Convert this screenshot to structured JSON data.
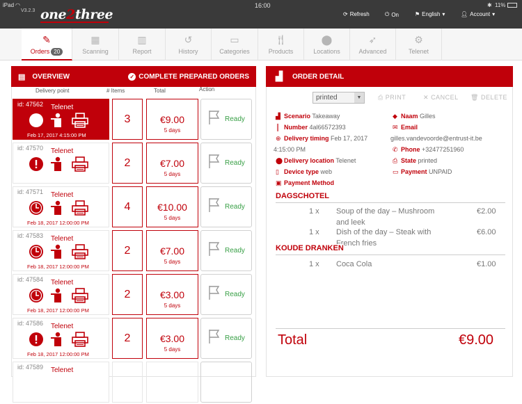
{
  "status": {
    "device": "iPad",
    "time": "16:00",
    "battery": "11%"
  },
  "app": {
    "version": "V3.2.3",
    "logo_a": "one",
    "logo_b": "2",
    "logo_c": "three"
  },
  "topnav": {
    "refresh": "Refresh",
    "on": "On",
    "language": "English",
    "account": "Account"
  },
  "nav": [
    {
      "label": "Orders",
      "badge": "20",
      "icon": "pencil-icon",
      "active": true
    },
    {
      "label": "Scanning",
      "icon": "qrcode-icon"
    },
    {
      "label": "Report",
      "icon": "bar-chart-icon"
    },
    {
      "label": "History",
      "icon": "history-icon"
    },
    {
      "label": "Categories",
      "icon": "folder-icon"
    },
    {
      "label": "Products",
      "icon": "cutlery-icon"
    },
    {
      "label": "Locations",
      "icon": "map-marker-icon"
    },
    {
      "label": "Advanced",
      "icon": "rocket-icon"
    },
    {
      "label": "Telenet",
      "icon": "gear-icon"
    }
  ],
  "overview": {
    "title": "OVERVIEW",
    "complete": "COMPLETE PREPARED ORDERS",
    "cols": {
      "delivery": "Delivery point",
      "items": "# Items",
      "total": "Total",
      "action": "Action"
    },
    "orders": [
      {
        "id": "id: 47562",
        "name": "Telenet",
        "date": "Feb 17, 2017 4:15:00 PM",
        "items": "3",
        "total": "€9.00",
        "days": "5 days",
        "action": "Ready",
        "status": "clock"
      },
      {
        "id": "id: 47570",
        "name": "Telenet",
        "date": "",
        "items": "2",
        "total": "€7.00",
        "days": "5 days",
        "action": "Ready",
        "status": "alert"
      },
      {
        "id": "id: 47571",
        "name": "Telenet",
        "date": "Feb 18, 2017 12:00:00 PM",
        "items": "4",
        "total": "€10.00",
        "days": "5 days",
        "action": "Ready",
        "status": "clock"
      },
      {
        "id": "id: 47583",
        "name": "Telenet",
        "date": "Feb 18, 2017 12:00:00 PM",
        "items": "2",
        "total": "€7.00",
        "days": "5 days",
        "action": "Ready",
        "status": "clock"
      },
      {
        "id": "id: 47584",
        "name": "Telenet",
        "date": "Feb 18, 2017 12:00:00 PM",
        "items": "2",
        "total": "€3.00",
        "days": "5 days",
        "action": "Ready",
        "status": "clock"
      },
      {
        "id": "id: 47586",
        "name": "Telenet",
        "date": "Feb 18, 2017 12:00:00 PM",
        "items": "2",
        "total": "€3.00",
        "days": "5 days",
        "action": "Ready",
        "status": "alert"
      },
      {
        "id": "id: 47589",
        "name": "Telenet",
        "date": "",
        "items": "",
        "total": "",
        "days": "",
        "action": "",
        "status": ""
      }
    ]
  },
  "detail": {
    "title": "ORDER DETAIL",
    "print_state": "printed",
    "print": "PRINT",
    "cancel": "CANCEL",
    "delete": "DELETE",
    "scenario_k": "Scenario",
    "scenario_v": "Takeaway",
    "number_k": "Number",
    "number_v": "4al66572393",
    "timing_k": "Delivery timing",
    "timing_v": "Feb 17, 2017",
    "timing_v2": "4:15:00 PM",
    "location_k": "Delivery location",
    "location_v": "Telenet",
    "device_k": "Device type",
    "device_v": "web",
    "payment_method_k": "Payment Method",
    "naam_k": "Naam",
    "naam_v": "Gilles",
    "email_k": "Email",
    "email_v": "gilles.vandevoorde@entrust-it.be",
    "phone_k": "Phone",
    "phone_v": "+32477251960",
    "state_k": "State",
    "state_v": "printed",
    "payment_k": "Payment",
    "payment_v": "UNPAID",
    "cats": [
      {
        "name": "DAGSCHOTEL",
        "items": [
          {
            "qty": "1 x",
            "name": "Soup of the day – Mushroom",
            "name2": "and leek",
            "price": "€2.00"
          },
          {
            "qty": "1 x",
            "name": "Dish of the day – Steak with",
            "name2": "French fries",
            "price": "€6.00"
          }
        ]
      },
      {
        "name": "KOUDE DRANKEN",
        "items": [
          {
            "qty": "1 x",
            "name": "Coca Cola",
            "name2": "",
            "price": "€1.00"
          }
        ]
      }
    ],
    "total_label": "Total",
    "total_value": "€9.00"
  },
  "colors": {
    "accent": "#c0000a",
    "ready": "#39a047",
    "topbar": "#3a3a3a"
  }
}
